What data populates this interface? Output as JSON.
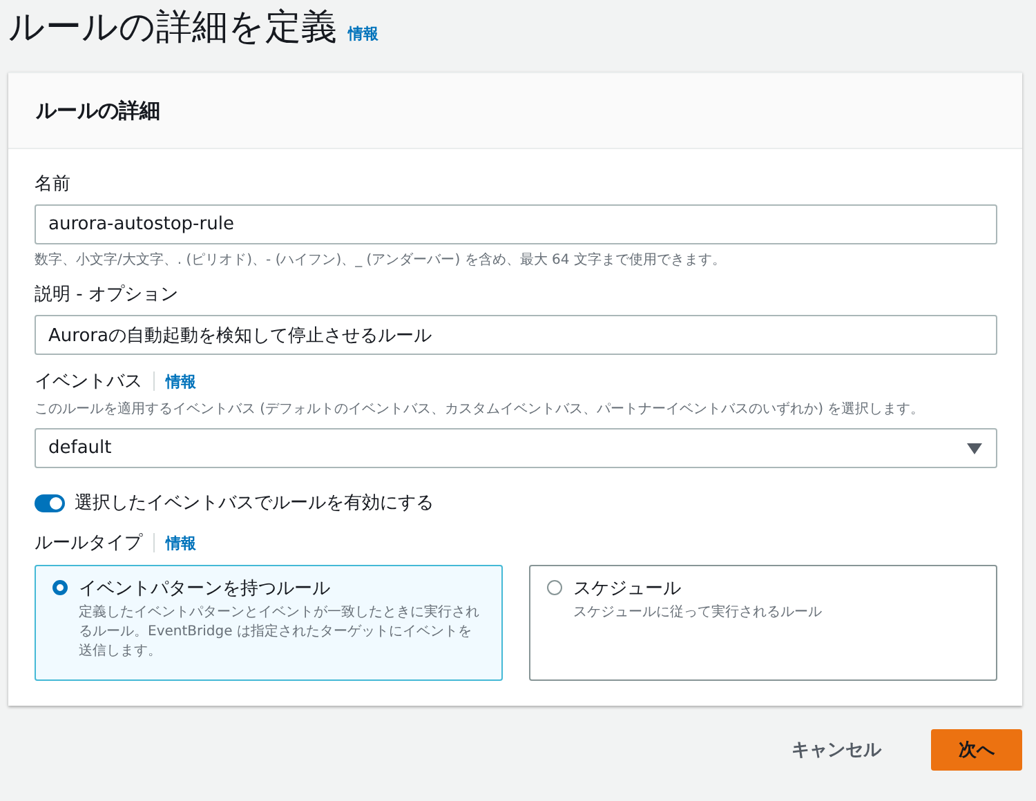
{
  "page": {
    "title": "ルールの詳細を定義",
    "info_link": "情報"
  },
  "panel": {
    "title": "ルールの詳細",
    "name": {
      "label": "名前",
      "value": "aurora-autostop-rule",
      "hint": "数字、小文字/大文字、. (ピリオド)、- (ハイフン)、_ (アンダーバー) を含め、最大 64 文字まで使用できます。"
    },
    "description": {
      "label": "説明 - オプション",
      "value": "Auroraの自動起動を検知して停止させるルール"
    },
    "event_bus": {
      "label": "イベントバス",
      "info_link": "情報",
      "hint": "このルールを適用するイベントバス (デフォルトのイベントバス、カスタムイベントバス、パートナーイベントバスのいずれか) を選択します。",
      "value": "default"
    },
    "enable_toggle": {
      "label": "選択したイベントバスでルールを有効にする",
      "on": true
    },
    "rule_type": {
      "label": "ルールタイプ",
      "info_link": "情報",
      "options": [
        {
          "title": "イベントパターンを持つルール",
          "description": "定義したイベントパターンとイベントが一致したときに実行されるルール。EventBridge は指定されたターゲットにイベントを送信します。",
          "selected": true
        },
        {
          "title": "スケジュール",
          "description": "スケジュールに従って実行されるルール",
          "selected": false
        }
      ]
    }
  },
  "buttons": {
    "cancel": "キャンセル",
    "next": "次へ"
  }
}
